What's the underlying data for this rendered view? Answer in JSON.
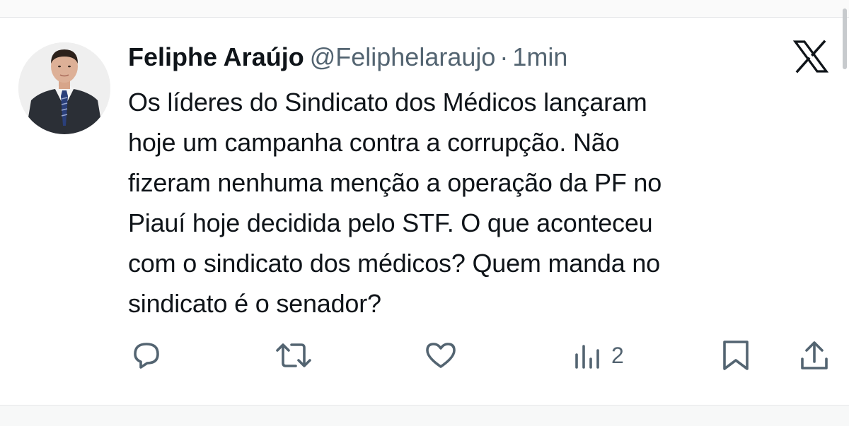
{
  "author": {
    "name": "Feliphe Araújo",
    "handle": "@Feliphelaraujo",
    "separator": "·",
    "time": "1min"
  },
  "tweet": {
    "lines": [
      "Os líderes do Sindicato dos Médicos lançaram",
      "hoje um campanha contra a corrupção. Não",
      "fizeram nenhuma menção a operação da PF no",
      "Piauí hoje decidida pelo STF. O que aconteceu",
      "com o sindicato dos médicos? Quem manda no",
      "sindicato é o senador?"
    ]
  },
  "actions": {
    "views_count": "2"
  },
  "icons": {
    "platform": "x-logo-icon",
    "reply": "reply-icon",
    "retweet": "retweet-icon",
    "like": "like-icon",
    "views": "views-icon",
    "bookmark": "bookmark-icon",
    "share": "share-icon"
  },
  "colors": {
    "text_primary": "#0f1419",
    "text_secondary": "#536471",
    "background": "#ffffff"
  }
}
